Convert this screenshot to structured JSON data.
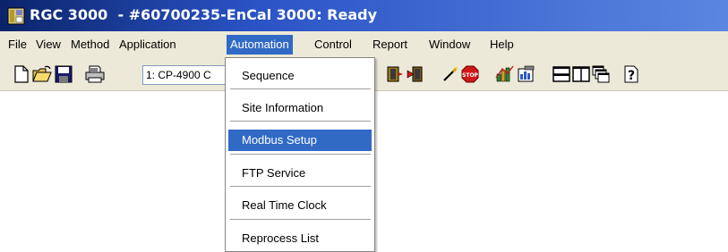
{
  "window": {
    "title": "RGC 3000  - #60700235-EnCal 3000: Ready"
  },
  "menubar": {
    "items": [
      {
        "label": "File"
      },
      {
        "label": "View"
      },
      {
        "label": "Method"
      },
      {
        "label": "Application"
      },
      {
        "label": "Automation"
      },
      {
        "label": "Control"
      },
      {
        "label": "Report"
      },
      {
        "label": "Window"
      },
      {
        "label": "Help"
      }
    ]
  },
  "toolbar": {
    "combo_value": "1: CP-4900 C",
    "icons": [
      "new-file-icon",
      "open-folder-icon",
      "save-icon",
      "print-icon",
      "run-icon",
      "exit-icon",
      "tool-icon",
      "stop-icon",
      "chart-icon",
      "report-icon",
      "tile-horizontal-icon",
      "tile-vertical-icon",
      "cascade-icon",
      "help-icon"
    ]
  },
  "automation_menu": {
    "items": [
      {
        "label": "Sequence"
      },
      {
        "label": "Site Information"
      },
      {
        "label": "Modbus Setup",
        "selected": true
      },
      {
        "label": "FTP Service"
      },
      {
        "label": "Real Time Clock"
      },
      {
        "label": "Reprocess List"
      }
    ]
  },
  "colors": {
    "highlight": "#316ac5",
    "title_bar_start": "#0a246a",
    "title_bar_end": "#5b86e0",
    "chrome": "#ece9d8"
  }
}
